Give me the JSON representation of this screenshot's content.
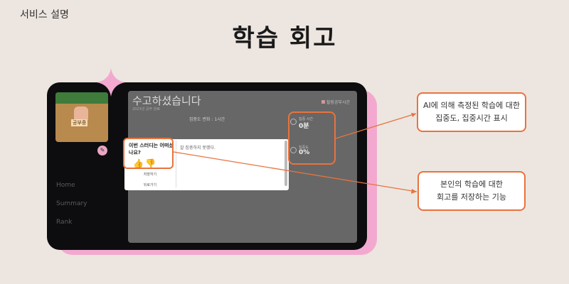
{
  "corner_label": "서비스 설명",
  "slide_title": "학습 회고",
  "app": {
    "thumbnail_tag": "공부중",
    "nav": [
      "Home",
      "Summary",
      "Rank"
    ],
    "screen": {
      "title": "수고하셨습니다",
      "subtitle": "2023년 공부 완료",
      "brand": "힐링공부시간",
      "focus_change_label": "집중도 변화 : 1시간",
      "stats": [
        {
          "icon": "clock-icon",
          "label": "집중 시간",
          "value": "0분"
        },
        {
          "icon": "target-icon",
          "label": "집중도",
          "value": "0%"
        }
      ]
    },
    "modal": {
      "question": "이번 스터디는 어떠셨나요?",
      "thumbs": "👍👎",
      "save_label": "저장하기",
      "back_label": "뒤로가기",
      "textarea_value": "잘 집중하지 못했다."
    }
  },
  "callouts": [
    {
      "line1": "AI에 의해 측정된 학습에 대한",
      "line2": "집중도, 집중시간 표시"
    },
    {
      "line1": "본인의 학습에 대한",
      "line2": "회고를 저장하는 기능"
    }
  ],
  "colors": {
    "background": "#ede6e0",
    "accent": "#e8733e",
    "device": "#0d0d10",
    "shadow_pink": "#f3a9cf"
  }
}
